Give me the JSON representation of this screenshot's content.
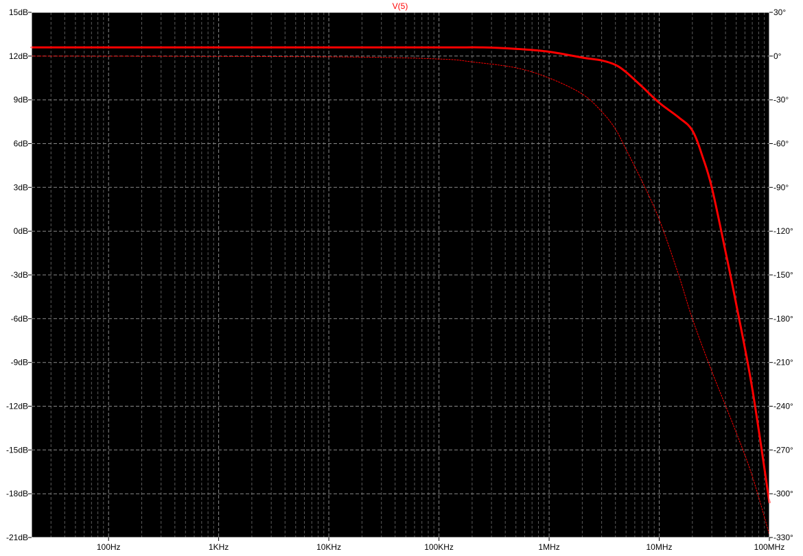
{
  "chart_data": {
    "type": "line",
    "title": "V(5)",
    "xlabel": "",
    "ylabel": "",
    "x_scale": "log",
    "xlim": [
      20,
      100000000
    ],
    "ylim": [
      -21,
      15
    ],
    "y2lim": [
      -330,
      30
    ],
    "grid": true,
    "x_ticks": [
      {
        "value": 100,
        "label": "100Hz"
      },
      {
        "value": 1000,
        "label": "1KHz"
      },
      {
        "value": 10000,
        "label": "10KHz"
      },
      {
        "value": 100000,
        "label": "100KHz"
      },
      {
        "value": 1000000,
        "label": "1MHz"
      },
      {
        "value": 10000000,
        "label": "10MHz"
      },
      {
        "value": 100000000,
        "label": "100MHz"
      }
    ],
    "y_ticks": [
      {
        "value": 15,
        "label": "15dB"
      },
      {
        "value": 12,
        "label": "12dB"
      },
      {
        "value": 9,
        "label": "9dB"
      },
      {
        "value": 6,
        "label": "6dB"
      },
      {
        "value": 3,
        "label": "3dB"
      },
      {
        "value": 0,
        "label": "0dB"
      },
      {
        "value": -3,
        "label": "-3dB"
      },
      {
        "value": -6,
        "label": "-6dB"
      },
      {
        "value": -9,
        "label": "-9dB"
      },
      {
        "value": -12,
        "label": "-12dB"
      },
      {
        "value": -15,
        "label": "-15dB"
      },
      {
        "value": -18,
        "label": "-18dB"
      },
      {
        "value": -21,
        "label": "-21dB"
      }
    ],
    "y2_ticks": [
      {
        "value": 30,
        "label": "30°"
      },
      {
        "value": 0,
        "label": "0°"
      },
      {
        "value": -30,
        "label": "-30°"
      },
      {
        "value": -60,
        "label": "-60°"
      },
      {
        "value": -90,
        "label": "-90°"
      },
      {
        "value": -120,
        "label": "-120°"
      },
      {
        "value": -150,
        "label": "-150°"
      },
      {
        "value": -180,
        "label": "-180°"
      },
      {
        "value": -210,
        "label": "-210°"
      },
      {
        "value": -240,
        "label": "-240°"
      },
      {
        "value": -270,
        "label": "-270°"
      },
      {
        "value": -300,
        "label": "-300°"
      },
      {
        "value": -330,
        "label": "-330°"
      }
    ],
    "series": [
      {
        "name": "V(5)",
        "kind": "magnitude",
        "axis": "left",
        "color": "#ff0000",
        "x": [
          20,
          1000,
          100000,
          250000,
          500000,
          1000000,
          2000000,
          3000000,
          4000000,
          5000000,
          7000000,
          10000000,
          15000000,
          20000000,
          25000000,
          30000000,
          40000000,
          50000000,
          70000000,
          100000000
        ],
        "values": [
          12.6,
          12.6,
          12.6,
          12.6,
          12.5,
          12.3,
          11.9,
          11.7,
          11.4,
          10.9,
          9.9,
          8.8,
          7.8,
          6.9,
          5.0,
          3.0,
          -1.4,
          -5.0,
          -10.8,
          -18.6
        ]
      },
      {
        "name": "V(5)",
        "kind": "phase",
        "axis": "right",
        "color": "#ff0000",
        "x": [
          20,
          10000,
          100000,
          200000,
          500000,
          1000000,
          2000000,
          3000000,
          4000000,
          5000000,
          7000000,
          10000000,
          15000000,
          20000000,
          30000000,
          50000000,
          70000000,
          100000000
        ],
        "values": [
          0,
          -0.5,
          -2,
          -4,
          -8,
          -15,
          -26,
          -38,
          -50,
          -64,
          -86,
          -112,
          -150,
          -180,
          -216,
          -258,
          -288,
          -328
        ]
      }
    ]
  }
}
